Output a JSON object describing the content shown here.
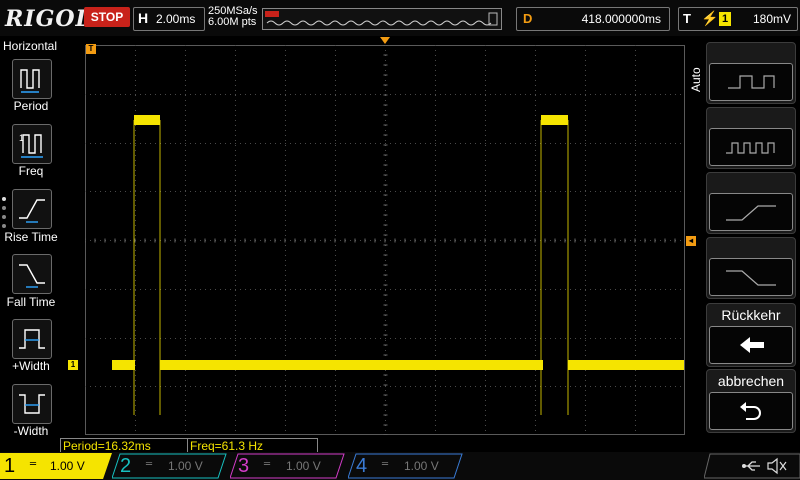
{
  "header": {
    "brand": "RIGOL",
    "run_state": "STOP",
    "timebase_key": "H",
    "timebase_value": "2.00ms",
    "sample_rate": "250MSa/s",
    "memory_depth": "6.00M pts",
    "delay_key": "D",
    "delay_value": "418.000000ms",
    "trigger_key": "T",
    "trigger_channel": "1",
    "trigger_level": "180mV"
  },
  "left_menu": {
    "title": "Horizontal",
    "items": [
      {
        "label": "Period"
      },
      {
        "label": "Freq"
      },
      {
        "label": "Rise Time"
      },
      {
        "label": "Fall Time"
      },
      {
        "label": "+Width"
      },
      {
        "label": "-Width"
      }
    ]
  },
  "right_menu": {
    "mode_label": "Auto",
    "back_label": "Rückkehr",
    "cancel_label": "abbrechen"
  },
  "measurements": {
    "period": "Period=16.32ms",
    "freq": "Freq=61.3 Hz"
  },
  "channels": [
    {
      "number": "1",
      "coupling": "═",
      "scale": "1.00 V",
      "color": "#f5e400",
      "active": true
    },
    {
      "number": "2",
      "coupling": "═",
      "scale": "1.00 V",
      "color": "#16c0c0",
      "active": false
    },
    {
      "number": "3",
      "coupling": "═",
      "scale": "1.00 V",
      "color": "#d23cc8",
      "active": false
    },
    {
      "number": "4",
      "coupling": "═",
      "scale": "1.00 V",
      "color": "#3a7bd5",
      "active": false
    }
  ],
  "colors": {
    "trace": "#f5e400",
    "stop": "#c8221a",
    "accent": "#f39c12"
  },
  "icons": {
    "usb": "usb-icon",
    "speaker": "speaker-muted-icon",
    "back": "arrow-left-icon",
    "undo": "undo-icon"
  }
}
